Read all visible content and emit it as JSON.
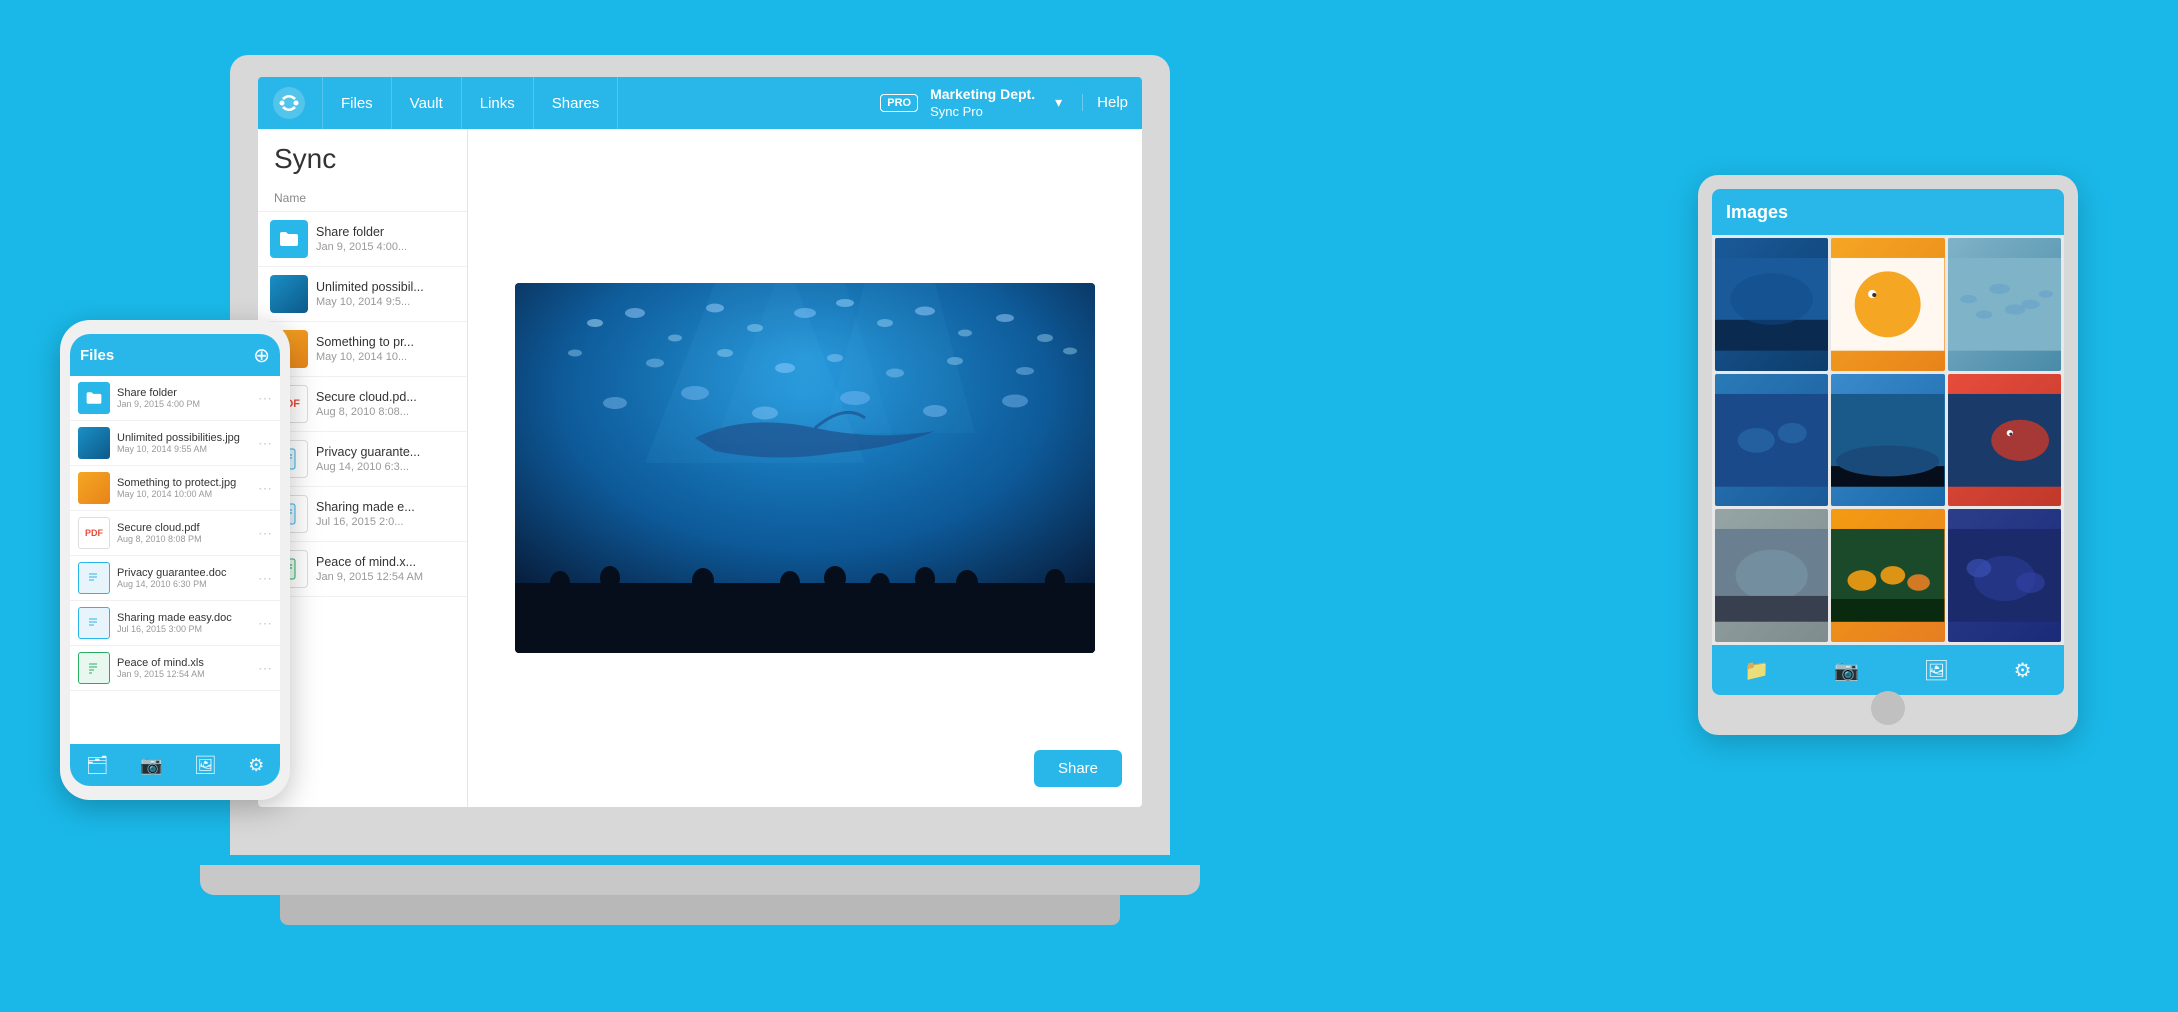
{
  "app": {
    "title": "Sync",
    "background_color": "#1ab8e8"
  },
  "laptop": {
    "nav": {
      "logo_alt": "Sync logo",
      "links": [
        "Files",
        "Vault",
        "Links",
        "Shares"
      ],
      "pro_label": "PRO",
      "account_name": "Marketing Dept.",
      "account_plan": "Sync Pro",
      "help_label": "Help"
    },
    "file_list": {
      "title": "Sync",
      "col_header": "Name",
      "files": [
        {
          "name": "Share folder",
          "date": "Jan 9, 2015  4:00...",
          "type": "folder"
        },
        {
          "name": "Unlimited possibil...",
          "date": "May 10, 2014  9:5...",
          "type": "img-blue"
        },
        {
          "name": "Something to pr...",
          "date": "May 10, 2014  10...",
          "type": "img-orange"
        },
        {
          "name": "Secure cloud.pd...",
          "date": "Aug 8, 2010  8:08...",
          "type": "pdf"
        },
        {
          "name": "Privacy guarante...",
          "date": "Aug 14, 2010  6:3...",
          "type": "doc-blue"
        },
        {
          "name": "Sharing made e...",
          "date": "Jul 16, 2015  2:00...",
          "type": "doc-blue"
        },
        {
          "name": "Peace of mind.x...",
          "date": "Jan 9, 2015  12:54 AM",
          "type": "doc-green"
        }
      ]
    },
    "share_button": "Share"
  },
  "phone": {
    "nav_title": "Files",
    "files": [
      {
        "name": "Share folder",
        "date": "Jan 9, 2015 4:00 PM",
        "type": "folder"
      },
      {
        "name": "Unlimited possibilities.jpg",
        "date": "May 10, 2014  9:55 AM",
        "type": "img-blue"
      },
      {
        "name": "Something to protect.jpg",
        "date": "May 10, 2014  10:00 AM",
        "type": "img-orange"
      },
      {
        "name": "Secure cloud.pdf",
        "date": "Aug 8, 2010  8:08 PM",
        "type": "pdf"
      },
      {
        "name": "Privacy guarantee.doc",
        "date": "Aug 14, 2010  6:30 PM",
        "type": "doc-blue"
      },
      {
        "name": "Sharing made easy.doc",
        "date": "Jul 16, 2015  3:00 PM",
        "type": "doc-blue"
      },
      {
        "name": "Peace of mind.xls",
        "date": "Jan 9, 2015  12:54 AM",
        "type": "doc-green"
      }
    ]
  },
  "tablet": {
    "title": "Images",
    "grid_images": [
      {
        "alt": "Underwater scene dark",
        "class": "img-cell-1"
      },
      {
        "alt": "Goldfish",
        "class": "img-cell-2"
      },
      {
        "alt": "School of fish",
        "class": "img-cell-3"
      },
      {
        "alt": "Blue aquarium fish",
        "class": "img-cell-4"
      },
      {
        "alt": "Underwater green",
        "class": "img-cell-5"
      },
      {
        "alt": "Red fish",
        "class": "img-cell-6"
      },
      {
        "alt": "Grey fish tank",
        "class": "img-cell-7"
      },
      {
        "alt": "Yellow tropical fish",
        "class": "img-cell-8"
      },
      {
        "alt": "Blue exotic fish",
        "class": "img-cell-9"
      }
    ]
  }
}
